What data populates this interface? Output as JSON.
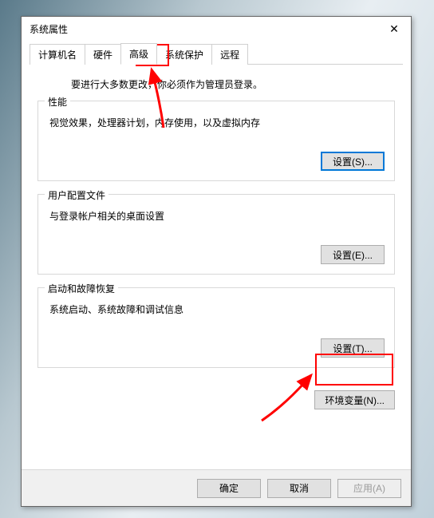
{
  "window": {
    "title": "系统属性"
  },
  "tabs": {
    "computer_name": "计算机名",
    "hardware": "硬件",
    "advanced": "高级",
    "system_protection": "系统保护",
    "remote": "远程"
  },
  "advanced": {
    "admin_note": "要进行大多数更改，你必须作为管理员登录。",
    "performance": {
      "title": "性能",
      "desc": "视觉效果，处理器计划，内存使用，以及虚拟内存",
      "settings_btn": "设置(S)..."
    },
    "user_profiles": {
      "title": "用户配置文件",
      "desc": "与登录帐户相关的桌面设置",
      "settings_btn": "设置(E)..."
    },
    "startup": {
      "title": "启动和故障恢复",
      "desc": "系统启动、系统故障和调试信息",
      "settings_btn": "设置(T)..."
    },
    "env_btn": "环境变量(N)..."
  },
  "buttons": {
    "ok": "确定",
    "cancel": "取消",
    "apply": "应用(A)"
  },
  "colors": {
    "annotation": "#ff0000",
    "focus_border": "#0078d7"
  }
}
